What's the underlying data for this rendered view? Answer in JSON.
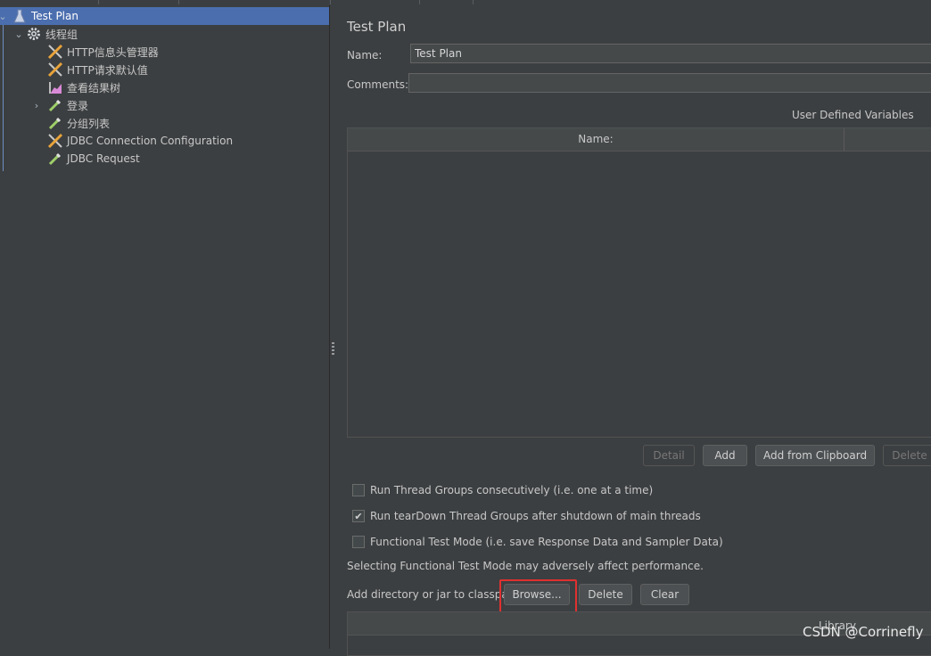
{
  "tree": {
    "items": [
      {
        "label": "Test Plan",
        "icon": "test-plan-icon"
      },
      {
        "label": "线程组",
        "icon": "gear-icon"
      },
      {
        "label": "HTTP信息头管理器",
        "icon": "wrench-icon"
      },
      {
        "label": "HTTP请求默认值",
        "icon": "wrench-icon"
      },
      {
        "label": "查看结果树",
        "icon": "chart-icon"
      },
      {
        "label": "登录",
        "icon": "pipette-icon"
      },
      {
        "label": "分组列表",
        "icon": "pipette-icon"
      },
      {
        "label": "JDBC Connection Configuration",
        "icon": "wrench-icon"
      },
      {
        "label": "JDBC Request",
        "icon": "pipette-icon"
      }
    ]
  },
  "panel": {
    "title": "Test Plan",
    "name_label": "Name:",
    "name_value": "Test Plan",
    "comments_label": "Comments:",
    "comments_value": "",
    "udv_title": "User Defined Variables",
    "table_header_name": "Name:"
  },
  "buttons": {
    "detail": "Detail",
    "add": "Add",
    "add_clipboard": "Add from Clipboard",
    "delete": "Delete",
    "browse": "Browse...",
    "cp_delete": "Delete",
    "clear": "Clear"
  },
  "checkboxes": [
    {
      "label": "Run Thread Groups consecutively (i.e. one at a time)",
      "checked": false
    },
    {
      "label": "Run tearDown Thread Groups after shutdown of main threads",
      "checked": true
    },
    {
      "label": "Functional Test Mode (i.e. save Response Data and Sampler Data)",
      "checked": false
    }
  ],
  "note": "Selecting Functional Test Mode may adversely affect performance.",
  "classpath_label": "Add directory or jar to classpath",
  "library_header": "Library",
  "watermark": "CSDN @Corrinefly",
  "colors": {
    "selection": "#4b6eaf",
    "highlight": "#e03030",
    "background": "#3c3f41"
  }
}
